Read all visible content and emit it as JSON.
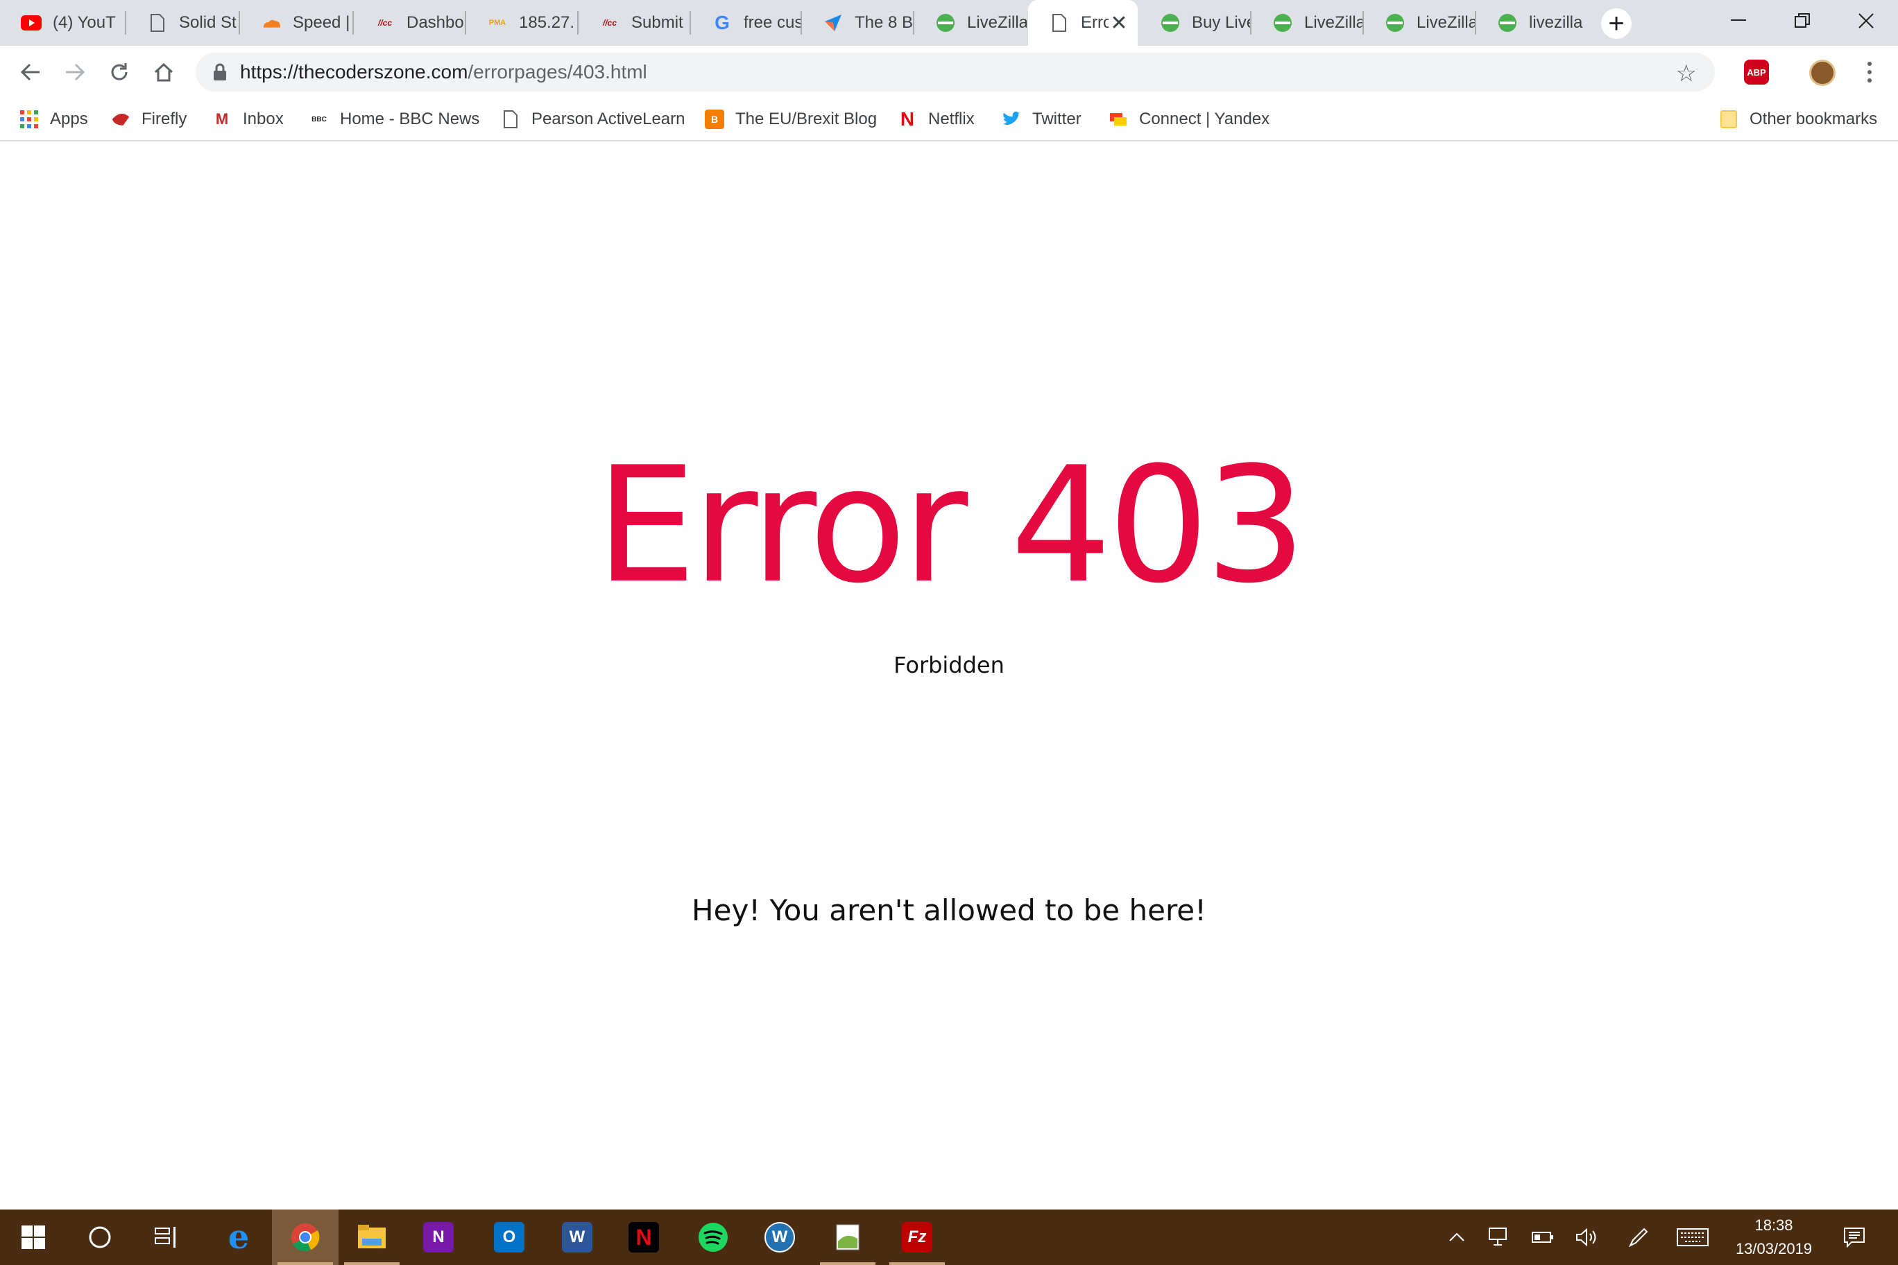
{
  "browser": {
    "tabs": [
      {
        "title": "(4) YouT",
        "icon": "youtube-icon",
        "color": "#ff0000"
      },
      {
        "title": "Solid St",
        "icon": "page-icon",
        "color": "#5f6368"
      },
      {
        "title": "Speed |",
        "icon": "cloudflare-icon",
        "color": "#f38020"
      },
      {
        "title": "Dashbo",
        "icon": "site-logo-icon",
        "color": "#b01010"
      },
      {
        "title": "185.27.",
        "icon": "pma-icon",
        "color": "#e9a010"
      },
      {
        "title": "Submit",
        "icon": "site-logo-icon",
        "color": "#b01010"
      },
      {
        "title": "free cus",
        "icon": "google-icon",
        "color": "#4285f4"
      },
      {
        "title": "The 8 B",
        "icon": "arrow-logo-icon",
        "color": "#1e88e5"
      },
      {
        "title": "LiveZilla",
        "icon": "livezilla-icon",
        "color": "#4caf50"
      },
      {
        "title": "Erro",
        "icon": "page-icon",
        "color": "#5f6368",
        "active": true
      },
      {
        "title": "Buy Live",
        "icon": "livezilla-icon",
        "color": "#4caf50"
      },
      {
        "title": "LiveZilla",
        "icon": "livezilla-icon",
        "color": "#4caf50"
      },
      {
        "title": "LiveZilla",
        "icon": "livezilla-icon",
        "color": "#4caf50"
      },
      {
        "title": "livezilla",
        "icon": "livezilla-icon",
        "color": "#4caf50"
      }
    ],
    "url_host": "https://thecoderszone.com",
    "url_path": "/errorpages/403.html",
    "bookmarks": [
      {
        "label": "Apps",
        "icon": "apps-grid-icon"
      },
      {
        "label": "Firefly",
        "icon": "firefly-icon"
      },
      {
        "label": "Inbox",
        "icon": "gmail-icon"
      },
      {
        "label": "Home - BBC News",
        "icon": "bbc-icon"
      },
      {
        "label": "Pearson ActiveLearn",
        "icon": "page-icon"
      },
      {
        "label": "The EU/Brexit Blog",
        "icon": "blogger-icon"
      },
      {
        "label": "Netflix",
        "icon": "netflix-icon"
      },
      {
        "label": "Twitter",
        "icon": "twitter-icon"
      },
      {
        "label": "Connect | Yandex",
        "icon": "yandex-icon"
      }
    ],
    "other_bookmarks": "Other bookmarks",
    "abp_label": "ABP"
  },
  "page": {
    "error_title": "Error 403",
    "error_subtitle": "Forbidden",
    "message": "Hey! You aren't allowed to be here!",
    "accent_color": "#e4093f"
  },
  "taskbar": {
    "time": "18:38",
    "date": "13/03/2019",
    "apps": [
      {
        "name": "edge",
        "label": "e"
      },
      {
        "name": "chrome",
        "label": ""
      },
      {
        "name": "file-explorer",
        "label": ""
      },
      {
        "name": "onenote",
        "label": "N"
      },
      {
        "name": "outlook",
        "label": "O"
      },
      {
        "name": "word",
        "label": "W"
      },
      {
        "name": "netflix",
        "label": "N"
      },
      {
        "name": "spotify",
        "label": ""
      },
      {
        "name": "wordpress-app",
        "label": "W"
      },
      {
        "name": "notepad-plus",
        "label": ""
      },
      {
        "name": "filezilla",
        "label": "Fz"
      }
    ]
  }
}
